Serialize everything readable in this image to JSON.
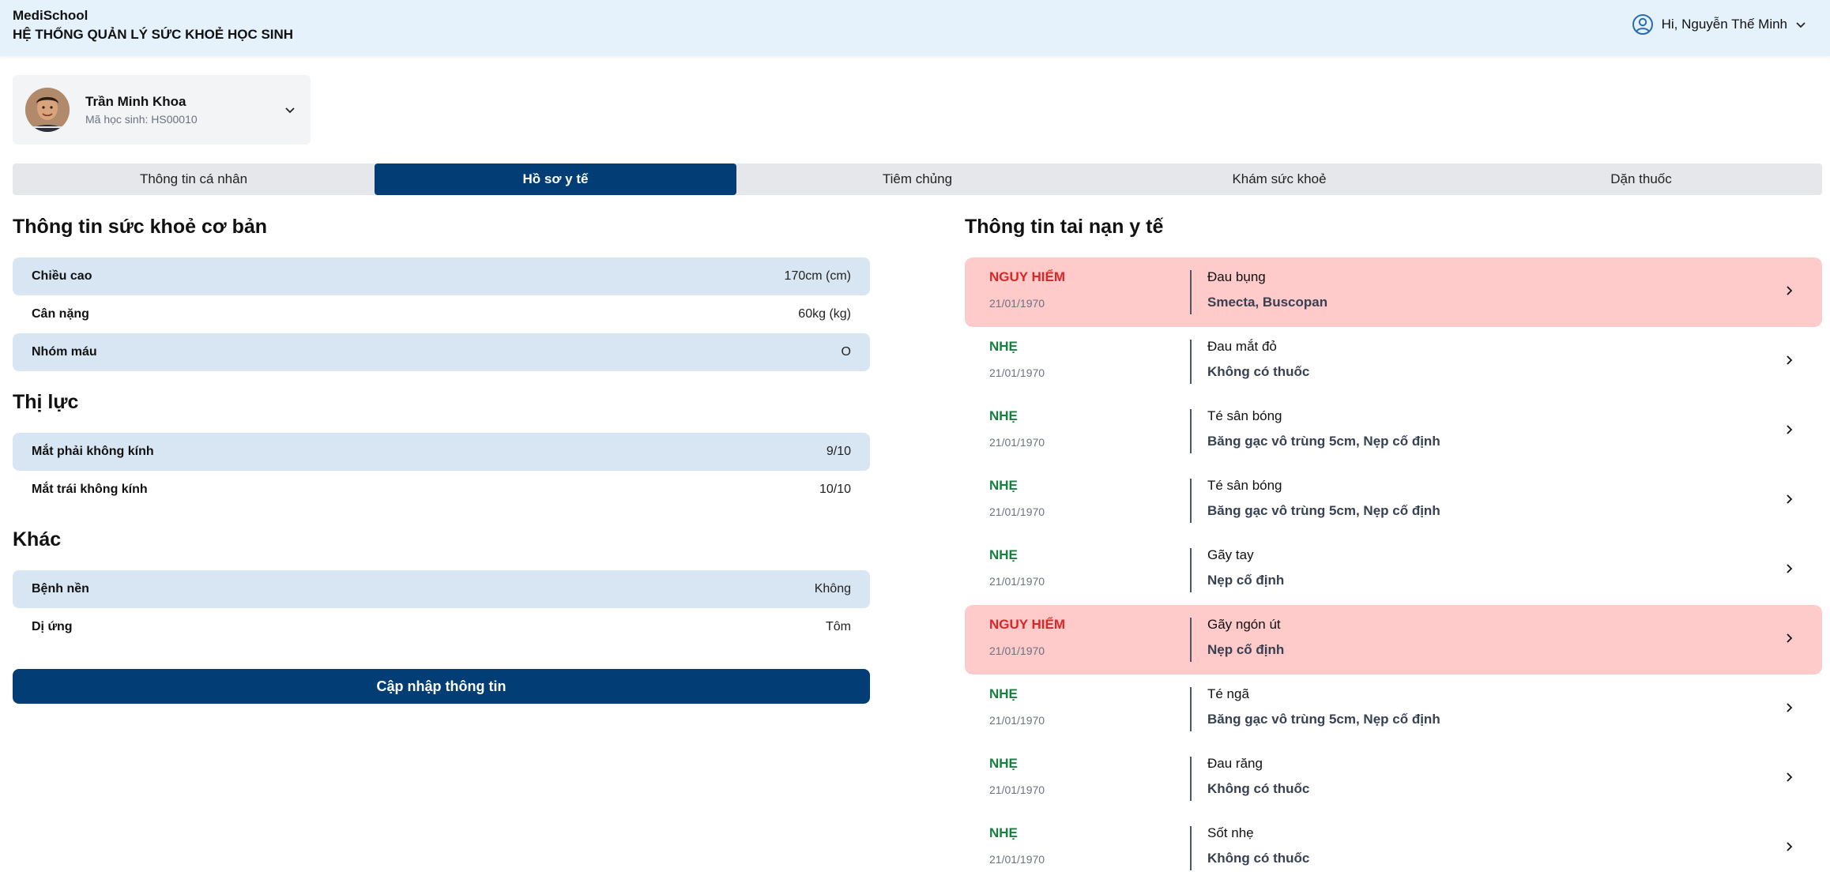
{
  "header": {
    "brand_name": "MediSchool",
    "system_title": "HỆ THỐNG QUẢN LÝ SỨC KHOẺ HỌC SINH",
    "greeting": "Hi, Nguyễn Thế Minh",
    "background": "#e6f2fb"
  },
  "student": {
    "name": "Trần Minh Khoa",
    "code_label": "Mã học sinh: HS00010"
  },
  "tabs": [
    {
      "label": "Thông tin cá nhân",
      "active": false
    },
    {
      "label": "Hồ sơ y tế",
      "active": true
    },
    {
      "label": "Tiêm chủng",
      "active": false
    },
    {
      "label": "Khám sức khoẻ",
      "active": false
    },
    {
      "label": "Dặn thuốc",
      "active": false
    }
  ],
  "health": {
    "basic_title": "Thông tin sức khoẻ cơ bản",
    "basic": [
      {
        "label": "Chiều cao",
        "value": "170cm (cm)"
      },
      {
        "label": "Cân nặng",
        "value": "60kg (kg)"
      },
      {
        "label": "Nhóm máu",
        "value": "O"
      }
    ],
    "vision_title": "Thị lực",
    "vision": [
      {
        "label": "Mắt phải không kính",
        "value": "9/10"
      },
      {
        "label": "Mắt trái không kính",
        "value": "10/10"
      }
    ],
    "other_title": "Khác",
    "other": [
      {
        "label": "Bệnh nền",
        "value": "Không"
      },
      {
        "label": "Dị ứng",
        "value": "Tôm"
      }
    ],
    "update_button": "Cập nhập thông tin"
  },
  "incidents": {
    "title": "Thông tin tai nạn y tế",
    "items": [
      {
        "severity": "NGUY HIỂM",
        "level": "danger",
        "date": "21/01/1970",
        "title": "Đau bụng",
        "meds": "Smecta, Buscopan"
      },
      {
        "severity": "NHẸ",
        "level": "mild",
        "date": "21/01/1970",
        "title": "Đau mắt đỏ",
        "meds": "Không có thuốc"
      },
      {
        "severity": "NHẸ",
        "level": "mild",
        "date": "21/01/1970",
        "title": "Té sân bóng",
        "meds": "Băng gạc vô trùng 5cm, Nẹp cố định"
      },
      {
        "severity": "NHẸ",
        "level": "mild",
        "date": "21/01/1970",
        "title": "Té sân bóng",
        "meds": "Băng gạc vô trùng 5cm, Nẹp cố định"
      },
      {
        "severity": "NHẸ",
        "level": "mild",
        "date": "21/01/1970",
        "title": "Gãy tay",
        "meds": "Nẹp cố định"
      },
      {
        "severity": "NGUY HIỂM",
        "level": "danger",
        "date": "21/01/1970",
        "title": "Gãy ngón út",
        "meds": "Nẹp cố định"
      },
      {
        "severity": "NHẸ",
        "level": "mild",
        "date": "21/01/1970",
        "title": "Té ngã",
        "meds": "Băng gạc vô trùng 5cm, Nẹp cố định"
      },
      {
        "severity": "NHẸ",
        "level": "mild",
        "date": "21/01/1970",
        "title": "Đau răng",
        "meds": "Không có thuốc"
      },
      {
        "severity": "NHẸ",
        "level": "mild",
        "date": "21/01/1970",
        "title": "Sốt nhẹ",
        "meds": "Không có thuốc"
      }
    ]
  },
  "colors": {
    "primary": "#023d75",
    "danger_bg": "#fecaca",
    "danger_text": "#dc2626",
    "mild_text": "#15803d",
    "row_shade": "#d8e6f4"
  }
}
